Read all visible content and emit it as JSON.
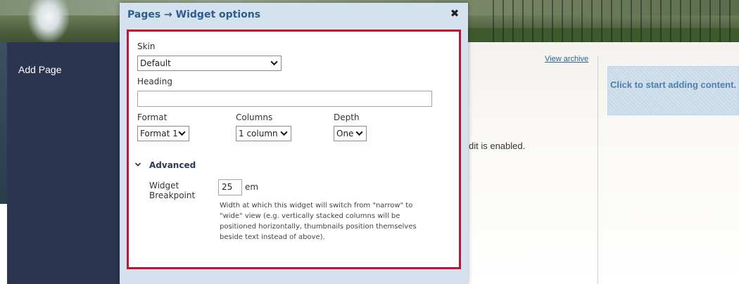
{
  "background": {
    "sidebar_add_page": "Add Page",
    "view_archive": "View archive",
    "partial_text": "dit is enabled.",
    "start_box_text": "Click to start adding content."
  },
  "dialog": {
    "title": "Pages → Widget options",
    "close_icon": "close-icon",
    "fields": {
      "skin": {
        "label": "Skin",
        "value": "Default"
      },
      "heading": {
        "label": "Heading",
        "value": ""
      },
      "format": {
        "label": "Format",
        "value": "Format 1"
      },
      "columns": {
        "label": "Columns",
        "value": "1 column"
      },
      "depth": {
        "label": "Depth",
        "value": "One"
      }
    },
    "advanced": {
      "label": "Advanced",
      "icon": "chevron-down-icon",
      "breakpoint": {
        "label": "Widget Breakpoint",
        "value": "25",
        "unit": "em",
        "help": "Width at which this widget will switch from \"narrow\" to \"wide\" view (e.g. vertically stacked columns will be positioned horizontally, thumbnails position themselves beside text instead of above)."
      }
    }
  },
  "colors": {
    "panel_border": "#c8102e",
    "dialog_bg": "#d4e1ef",
    "title_text": "#2c5d8f",
    "sidebar_bg": "#2c3550"
  }
}
